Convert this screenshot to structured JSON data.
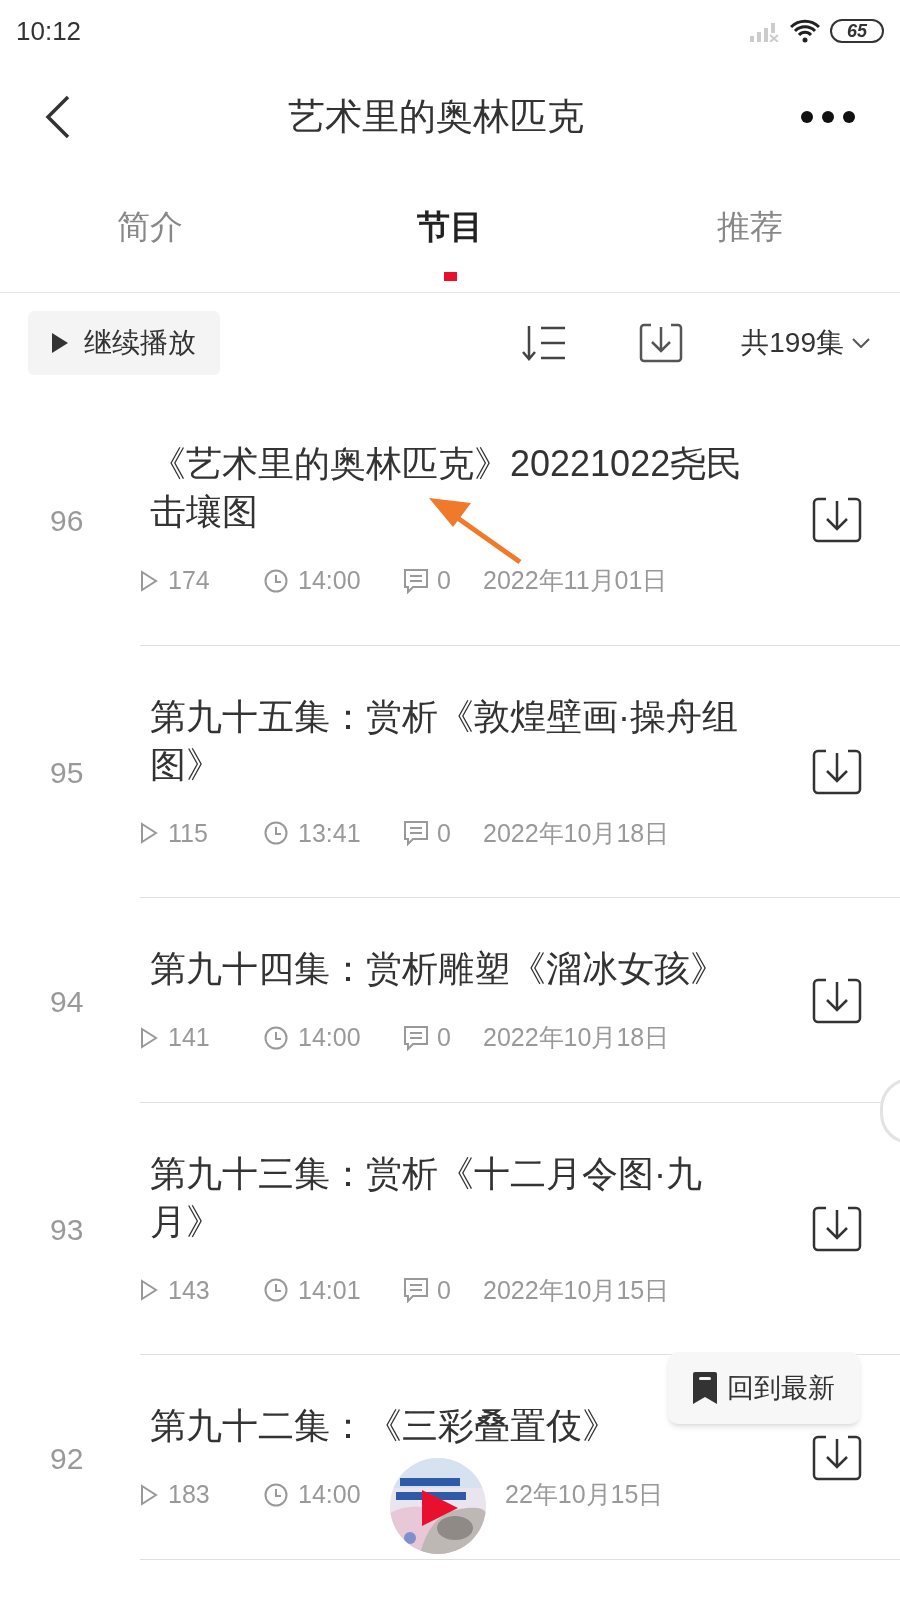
{
  "status_bar": {
    "time": "10:12",
    "battery": "65"
  },
  "header": {
    "title": "艺术里的奥林匹克"
  },
  "tabs": [
    {
      "label": "简介",
      "selected": false
    },
    {
      "label": "节目",
      "selected": true
    },
    {
      "label": "推荐",
      "selected": false
    }
  ],
  "toolbar": {
    "continue_button": "继续播放",
    "episode_count": "共199集"
  },
  "episodes": [
    {
      "number": "96",
      "title": "《艺术里的奥林匹克》20221022尧民击壤图",
      "plays": "174",
      "duration": "14:00",
      "comments": "0",
      "date": "2022年11月01日"
    },
    {
      "number": "95",
      "title": "第九十五集：赏析《敦煌壁画·操舟组图》",
      "plays": "115",
      "duration": "13:41",
      "comments": "0",
      "date": "2022年10月18日"
    },
    {
      "number": "94",
      "title": "第九十四集：赏析雕塑《溜冰女孩》",
      "plays": "141",
      "duration": "14:00",
      "comments": "0",
      "date": "2022年10月18日"
    },
    {
      "number": "93",
      "title": "第九十三集：赏析《十二月令图·九月》",
      "plays": "143",
      "duration": "14:01",
      "comments": "0",
      "date": "2022年10月15日"
    },
    {
      "number": "92",
      "title": "第九十二集：《三彩叠置伎》",
      "plays": "183",
      "duration": "14:00",
      "date": "22年10月15日"
    }
  ],
  "back_to_latest_button": "回到最新"
}
